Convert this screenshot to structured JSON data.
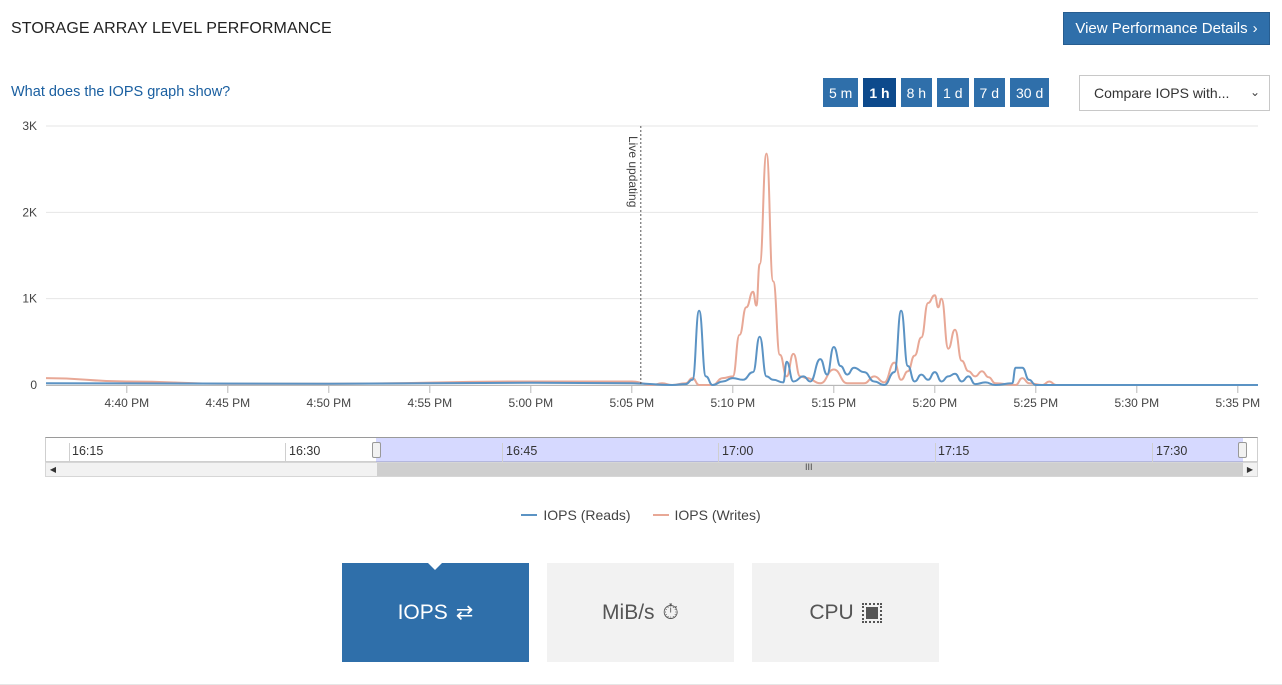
{
  "header": {
    "title": "STORAGE ARRAY LEVEL PERFORMANCE",
    "details_button": "View Performance Details",
    "details_chevron": "›"
  },
  "help_link": "What does the IOPS graph show?",
  "time_ranges": [
    {
      "label": "5 m",
      "active": false
    },
    {
      "label": "1 h",
      "active": true
    },
    {
      "label": "8 h",
      "active": false
    },
    {
      "label": "1 d",
      "active": false
    },
    {
      "label": "7 d",
      "active": false
    },
    {
      "label": "30 d",
      "active": false
    }
  ],
  "compare": {
    "selected": "Compare IOPS with...",
    "caret": "⌄"
  },
  "chart_data": {
    "type": "line",
    "x_unit": "time",
    "x_range": [
      "4:36 PM",
      "5:36 PM"
    ],
    "xticks": [
      "4:40 PM",
      "4:45 PM",
      "4:50 PM",
      "4:55 PM",
      "5:00 PM",
      "5:05 PM",
      "5:10 PM",
      "5:15 PM",
      "5:20 PM",
      "5:25 PM",
      "5:30 PM",
      "5:35 PM"
    ],
    "yticks": [
      "0",
      "1K",
      "2K",
      "3K"
    ],
    "ylim": [
      0,
      3000
    ],
    "grid": true,
    "legend": "bottom",
    "annotation": {
      "text": "Live updating",
      "x": "5:05 PM"
    },
    "series": [
      {
        "name": "IOPS (Reads)",
        "color": "#5b93c4",
        "points": [
          [
            "4:36:00",
            20
          ],
          [
            "4:50:00",
            15
          ],
          [
            "5:00:00",
            25
          ],
          [
            "5:05:00",
            20
          ],
          [
            "5:07:00",
            0
          ],
          [
            "5:07:40",
            10
          ],
          [
            "5:08:00",
            60
          ],
          [
            "5:08:20",
            860
          ],
          [
            "5:08:40",
            100
          ],
          [
            "5:09:00",
            0
          ],
          [
            "5:09:30",
            40
          ],
          [
            "5:10:00",
            80
          ],
          [
            "5:10:30",
            60
          ],
          [
            "5:11:00",
            150
          ],
          [
            "5:11:20",
            560
          ],
          [
            "5:11:40",
            100
          ],
          [
            "5:12:00",
            60
          ],
          [
            "5:12:30",
            30
          ],
          [
            "5:12:40",
            270
          ],
          [
            "5:13:00",
            40
          ],
          [
            "5:13:30",
            100
          ],
          [
            "5:13:50",
            40
          ],
          [
            "5:14:20",
            300
          ],
          [
            "5:14:40",
            120
          ],
          [
            "5:15:00",
            440
          ],
          [
            "5:15:20",
            220
          ],
          [
            "5:15:40",
            120
          ],
          [
            "5:16:00",
            200
          ],
          [
            "5:16:30",
            150
          ],
          [
            "5:17:00",
            40
          ],
          [
            "5:17:30",
            0
          ],
          [
            "5:18:00",
            150
          ],
          [
            "5:18:20",
            860
          ],
          [
            "5:18:40",
            220
          ],
          [
            "5:19:00",
            40
          ],
          [
            "5:19:20",
            120
          ],
          [
            "5:19:40",
            60
          ],
          [
            "5:20:00",
            150
          ],
          [
            "5:20:20",
            40
          ],
          [
            "5:20:40",
            100
          ],
          [
            "5:21:00",
            130
          ],
          [
            "5:21:20",
            40
          ],
          [
            "5:21:40",
            100
          ],
          [
            "5:22:00",
            10
          ],
          [
            "5:22:30",
            30
          ],
          [
            "5:23:00",
            0
          ],
          [
            "5:23:50",
            20
          ],
          [
            "5:24:00",
            200
          ],
          [
            "5:24:20",
            200
          ],
          [
            "5:24:40",
            60
          ],
          [
            "5:25:00",
            0
          ],
          [
            "5:36:00",
            0
          ]
        ]
      },
      {
        "name": "IOPS (Writes)",
        "color": "#e8a896",
        "points": [
          [
            "4:36:00",
            80
          ],
          [
            "4:40:00",
            40
          ],
          [
            "4:45:00",
            15
          ],
          [
            "4:50:00",
            15
          ],
          [
            "5:00:00",
            40
          ],
          [
            "5:05:00",
            40
          ],
          [
            "5:06:00",
            0
          ],
          [
            "5:06:30",
            20
          ],
          [
            "5:07:00",
            0
          ],
          [
            "5:07:40",
            20
          ],
          [
            "5:08:00",
            80
          ],
          [
            "5:08:20",
            0
          ],
          [
            "5:09:00",
            0
          ],
          [
            "5:09:30",
            80
          ],
          [
            "5:10:00",
            100
          ],
          [
            "5:10:20",
            580
          ],
          [
            "5:10:40",
            900
          ],
          [
            "5:11:00",
            1080
          ],
          [
            "5:11:10",
            920
          ],
          [
            "5:11:20",
            1400
          ],
          [
            "5:11:40",
            2680
          ],
          [
            "5:12:00",
            1200
          ],
          [
            "5:12:20",
            350
          ],
          [
            "5:12:40",
            100
          ],
          [
            "5:13:00",
            360
          ],
          [
            "5:13:20",
            100
          ],
          [
            "5:13:40",
            80
          ],
          [
            "5:14:20",
            20
          ],
          [
            "5:15:00",
            180
          ],
          [
            "5:15:40",
            20
          ],
          [
            "5:16:30",
            20
          ],
          [
            "5:17:00",
            100
          ],
          [
            "5:17:30",
            30
          ],
          [
            "5:18:00",
            260
          ],
          [
            "5:18:20",
            60
          ],
          [
            "5:18:40",
            160
          ],
          [
            "5:19:00",
            340
          ],
          [
            "5:19:20",
            550
          ],
          [
            "5:19:40",
            950
          ],
          [
            "5:20:00",
            1040
          ],
          [
            "5:20:10",
            900
          ],
          [
            "5:20:20",
            1000
          ],
          [
            "5:20:40",
            420
          ],
          [
            "5:21:00",
            640
          ],
          [
            "5:21:20",
            280
          ],
          [
            "5:21:40",
            160
          ],
          [
            "5:22:00",
            100
          ],
          [
            "5:22:20",
            160
          ],
          [
            "5:22:40",
            90
          ],
          [
            "5:23:00",
            20
          ],
          [
            "5:24:00",
            0
          ],
          [
            "5:24:20",
            80
          ],
          [
            "5:24:40",
            20
          ],
          [
            "5:25:20",
            0
          ],
          [
            "5:25:40",
            40
          ],
          [
            "5:26:00",
            0
          ],
          [
            "5:36:00",
            0
          ]
        ]
      }
    ]
  },
  "navigator": {
    "ticks": [
      "16:15",
      "16:30",
      "16:45",
      "17:00",
      "17:15",
      "17:30"
    ],
    "grip": "III",
    "left_arrow": "◀",
    "right_arrow": "▶"
  },
  "metric_tabs": [
    {
      "label": "IOPS",
      "icon": "exchange-arrows-icon",
      "glyph": "⇄",
      "active": true
    },
    {
      "label": "MiB/s",
      "icon": "stopwatch-icon",
      "glyph": "⏱",
      "active": false
    },
    {
      "label": "CPU",
      "icon": "cpu-chip-icon",
      "glyph": "",
      "active": false
    }
  ]
}
